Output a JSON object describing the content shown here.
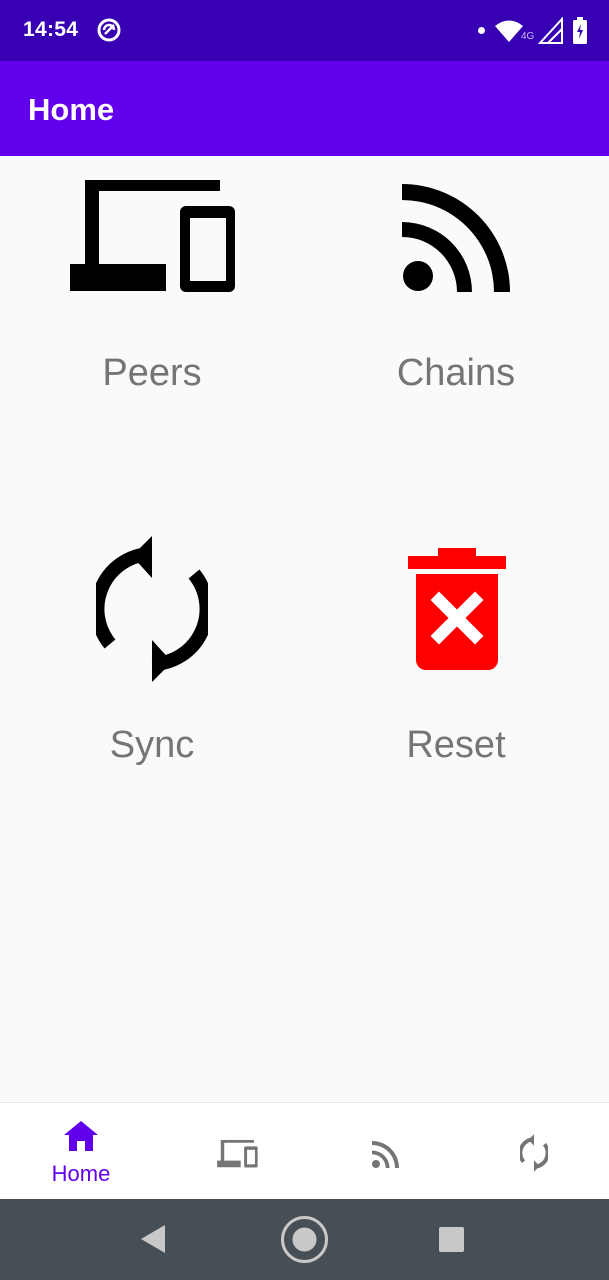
{
  "status_bar": {
    "time": "14:54",
    "network_label": "4G",
    "icons": [
      "app-notification-icon",
      "dot-indicator",
      "wifi-icon",
      "cell-signal-icon",
      "battery-charging-icon"
    ]
  },
  "app_bar": {
    "title": "Home"
  },
  "tiles": [
    {
      "label": "Peers",
      "icon": "devices-icon",
      "color": "#000000"
    },
    {
      "label": "Chains",
      "icon": "rss-feed-icon",
      "color": "#000000"
    },
    {
      "label": "Sync",
      "icon": "sync-icon",
      "color": "#000000"
    },
    {
      "label": "Reset",
      "icon": "delete-forever-icon",
      "color": "#ff0000"
    }
  ],
  "bottom_nav": {
    "items": [
      {
        "label": "Home",
        "icon": "home-icon",
        "selected": true
      },
      {
        "icon": "devices-icon",
        "selected": false
      },
      {
        "icon": "rss-feed-icon",
        "selected": false
      },
      {
        "icon": "sync-icon",
        "selected": false
      }
    ],
    "accent_color": "#6200ee",
    "inactive_color": "#757575"
  },
  "system_nav": {
    "buttons": [
      "back-icon",
      "home-circle-icon",
      "recents-icon"
    ]
  },
  "colors": {
    "status_bar": "#3700b3",
    "app_bar": "#6200ee",
    "background": "#fafafa",
    "label": "#757575",
    "system_nav": "#474f56"
  }
}
